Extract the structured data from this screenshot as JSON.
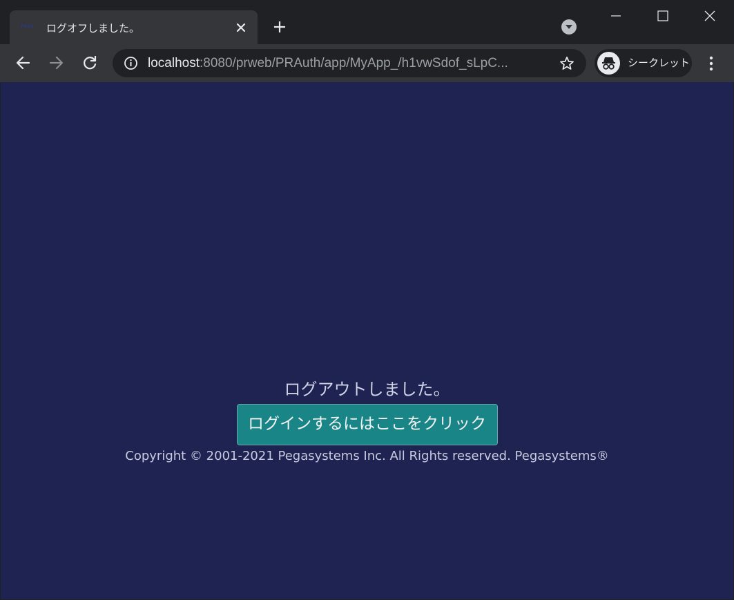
{
  "browser": {
    "tab": {
      "favicon_text": "PEGA",
      "title": "ログオフしました。"
    },
    "address_bar": {
      "host": "localhost",
      "path": ":8080/prweb/PRAuth/app/MyApp_/h1vwSdof_sLpC..."
    },
    "profile": {
      "label": "シークレット"
    }
  },
  "page": {
    "background": "#1f2352",
    "message": "ログアウトしました。",
    "login_button": "ログインするにはここをクリック",
    "login_button_color": "#1a8586",
    "copyright": "Copyright © 2001-2021 Pegasystems Inc. All Rights reserved. Pegasystems®"
  }
}
